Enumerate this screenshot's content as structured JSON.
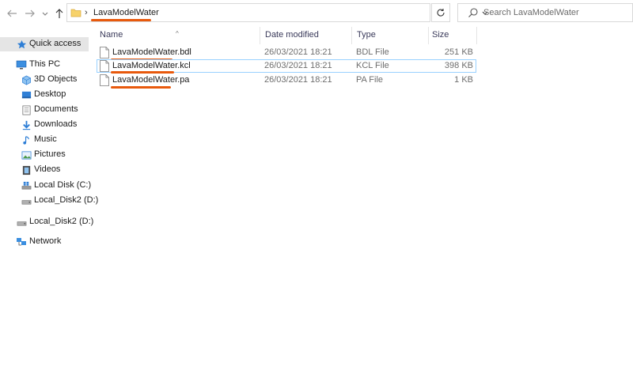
{
  "address_bar": {
    "breadcrumb_separator": "›",
    "current_folder": "LavaModelWater"
  },
  "search": {
    "placeholder": "Search LavaModelWater"
  },
  "nav_pane": {
    "quick_access": "Quick access",
    "this_pc": "This PC",
    "items": [
      {
        "label": "3D Objects",
        "icon": "3d-objects-icon"
      },
      {
        "label": "Desktop",
        "icon": "desktop-icon"
      },
      {
        "label": "Documents",
        "icon": "documents-icon"
      },
      {
        "label": "Downloads",
        "icon": "downloads-icon"
      },
      {
        "label": "Music",
        "icon": "music-icon"
      },
      {
        "label": "Pictures",
        "icon": "pictures-icon"
      },
      {
        "label": "Videos",
        "icon": "videos-icon"
      },
      {
        "label": "Local Disk (C:)",
        "icon": "local-disk-icon"
      },
      {
        "label": "Local_Disk2 (D:)",
        "icon": "drive-icon"
      }
    ],
    "drive_d": "Local_Disk2 (D:)",
    "network": "Network"
  },
  "file_list": {
    "columns": {
      "name": "Name",
      "date_modified": "Date modified",
      "type": "Type",
      "size": "Size"
    },
    "files": [
      {
        "name": "LavaModelWater.bdl",
        "date_modified": "26/03/2021 18:21",
        "type": "BDL File",
        "size": "251 KB"
      },
      {
        "name": "LavaModelWater.kcl",
        "date_modified": "26/03/2021 18:21",
        "type": "KCL File",
        "size": "398 KB"
      },
      {
        "name": "LavaModelWater.pa",
        "date_modified": "26/03/2021 18:21",
        "type": "PA File",
        "size": "1 KB"
      }
    ]
  },
  "colors": {
    "highlight_underline": "#e8590c",
    "selection_border": "#99d1ff",
    "folder_yellow": "#f7d26a"
  }
}
